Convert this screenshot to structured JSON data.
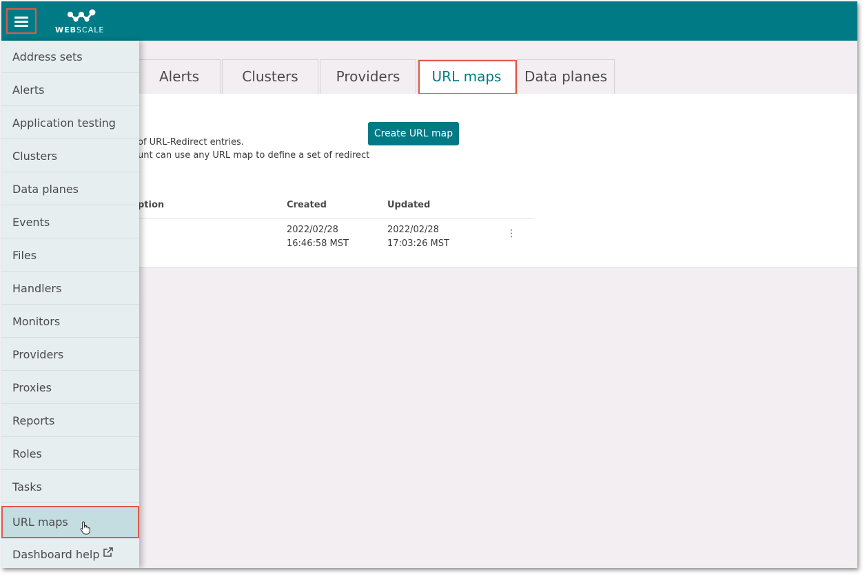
{
  "brand": {
    "logo_text_bold": "WEB",
    "logo_text_light": "SCALE",
    "primary_color": "#007b86",
    "highlight_color": "#e0584a"
  },
  "header": {
    "menu_icon": "hamburger-menu-icon"
  },
  "tabs": [
    {
      "label": "Alerts"
    },
    {
      "label": "Clusters"
    },
    {
      "label": "Providers"
    },
    {
      "label": "URL maps",
      "active": true
    },
    {
      "label": "Data planes"
    }
  ],
  "main": {
    "description_line1": "of URL-Redirect entries.",
    "description_line2": "unt can use any URL map to define a set of redirect",
    "create_button": "Create URL map",
    "table": {
      "headers": [
        "ption",
        "Created",
        "Updated"
      ],
      "rows": [
        {
          "created_date": "2022/02/28",
          "created_time": "16:46:58 MST",
          "updated_date": "2022/02/28",
          "updated_time": "17:03:26 MST",
          "actions_icon": "kebab-menu-icon"
        }
      ]
    }
  },
  "drawer": {
    "items": [
      {
        "label": "Address sets"
      },
      {
        "label": "Alerts"
      },
      {
        "label": "Application testing"
      },
      {
        "label": "Clusters"
      },
      {
        "label": "Data planes"
      },
      {
        "label": "Events"
      },
      {
        "label": "Files"
      },
      {
        "label": "Handlers"
      },
      {
        "label": "Monitors"
      },
      {
        "label": "Providers"
      },
      {
        "label": "Proxies"
      },
      {
        "label": "Reports"
      },
      {
        "label": "Roles"
      },
      {
        "label": "Tasks"
      },
      {
        "label": "URL maps",
        "selected": true
      },
      {
        "label": "Dashboard help",
        "icon": "external-link-icon"
      }
    ]
  }
}
